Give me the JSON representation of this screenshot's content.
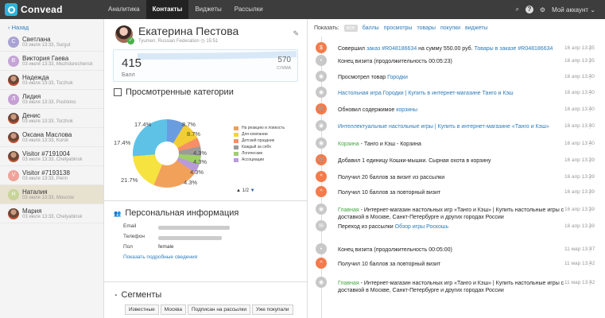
{
  "app": {
    "name": "Convead"
  },
  "nav": {
    "items": [
      {
        "label": "Аналитика"
      },
      {
        "label": "Контакты"
      },
      {
        "label": "Виджеты"
      },
      {
        "label": "Рассылки"
      }
    ],
    "account": "Мой аккаунт"
  },
  "sidebar": {
    "back": "Назад",
    "contacts": [
      {
        "name": "Светлана",
        "meta": "03 июля 13:33, Surgut",
        "initial": "С",
        "color": "#a9a3d4"
      },
      {
        "name": "Виктория Гаева",
        "meta": "03 июля 13:33, Mezhdurechensk",
        "initial": "В",
        "color": "#c5a5d6"
      },
      {
        "name": "Надежда",
        "meta": "03 июля 13:33, Torzhok",
        "initial": "",
        "color": "#9a6a5a"
      },
      {
        "name": "Лидия",
        "meta": "03 июля 13:33, Pushkino",
        "initial": "Л",
        "color": "#c6a0d4"
      },
      {
        "name": "Денис",
        "meta": "03 июля 13:33, Torzhok",
        "initial": "",
        "color": "#6f5b52"
      },
      {
        "name": "Оксана Маслова",
        "meta": "03 июля 13:33, Kursk",
        "initial": "",
        "color": "#8f6e5e"
      },
      {
        "name": "Visitor #7191004",
        "meta": "03 июля 13:33, Chelyabinsk",
        "initial": "",
        "color": "#8e6856"
      },
      {
        "name": "Visitor #7193138",
        "meta": "03 июля 13:33, Perm",
        "initial": "V",
        "color": "#f0a39a"
      },
      {
        "name": "Наталия",
        "meta": "03 июля 13:33, Moscow",
        "initial": "Н",
        "color": "#c8d49a"
      },
      {
        "name": "Мария",
        "meta": "03 июля 13:33, Chelyabinsk",
        "initial": "",
        "color": "#8d6e61"
      }
    ]
  },
  "profile": {
    "name": "Екатерина Пестова",
    "location": "Tyumen, Russian Federation",
    "time": "15:51",
    "score": "415",
    "score_label": "Балл",
    "total": "570",
    "total_label": "СУММА"
  },
  "categories": {
    "title": "Просмотренные категории",
    "legend": [
      "На реакцию и ловкость",
      "Для компании",
      "Детский праздник",
      "Каждый за себя",
      "Логические",
      "Ассоциации"
    ],
    "pager": "1/2",
    "percents": [
      "17.4%",
      "8.7%",
      "8.7%",
      "17.4%",
      "4.3%",
      "4.3%",
      "4.3%",
      "4.3%",
      "21.7%"
    ]
  },
  "personal": {
    "title": "Персональная информация",
    "email_label": "Email",
    "phone_label": "Телефон",
    "gender_label": "Пол",
    "gender": "female",
    "more_link": "Показать подробные сведения"
  },
  "segments": {
    "title": "Сегменты",
    "tags": [
      "Известные",
      "Москва",
      "Подписан на рассылки",
      "Уже покупали"
    ]
  },
  "events": {
    "filter_label": "Показать:",
    "filters": [
      "все",
      "баллы",
      "просмотры",
      "товары",
      "покупки",
      "виджеты"
    ],
    "items": [
      {
        "pre": "Совершил ",
        "link": "заказ #R048186634",
        "mid": " на сумму 550.00 руб. ",
        "link2": "Товары в заказе #R048186634",
        "date": "16 апр 13:35",
        "icon": "$",
        "color": "orange"
      },
      {
        "pre": "Конец визита (продолжительность 00:05:23)",
        "link": "",
        "mid": "",
        "link2": "",
        "date": "16 апр 13:35",
        "icon": "•",
        "color": "gray"
      },
      {
        "pre": "Просмотрел товар ",
        "link": "Городки",
        "mid": "",
        "link2": "",
        "date": "16 апр 13:40",
        "icon": "◉",
        "color": "gray"
      },
      {
        "pre": "",
        "link": "Настольная игра Городки | Купить в интернет-магазине Танго и Кэш",
        "mid": "",
        "link2": "",
        "date": "16 апр 13:40",
        "icon": "◉",
        "color": "gray"
      },
      {
        "pre": "Обновил содержимое ",
        "link": "корзины",
        "mid": "",
        "link2": "",
        "date": "16 апр 13:40",
        "icon": "🛒",
        "color": "orange"
      },
      {
        "pre": "",
        "link": "Интеллектуальные настольные игры | Купить в интернет-магазине «Танго и Кэш»",
        "mid": "",
        "link2": "",
        "date": "16 апр 13:40",
        "icon": "◉",
        "color": "gray"
      },
      {
        "pre": "",
        "link": "Корзина",
        "mid": " - Танго и Кэш - Корзина",
        "link2": "",
        "date": "16 апр 13:40",
        "icon": "◉",
        "color": "gray"
      },
      {
        "pre": "Добавил 1 единицу Кошки-мышки. Сырная охота в корзину",
        "link": "",
        "mid": "",
        "link2": "",
        "date": "16 апр 13:39",
        "icon": "🛒",
        "color": "orange"
      },
      {
        "pre": "Получил 20 баллов за визит из рассылки",
        "link": "",
        "mid": "",
        "link2": "",
        "date": "16 апр 13:39",
        "icon": "^",
        "color": "orange"
      },
      {
        "pre": "Получил 10 баллов за повторный визит",
        "link": "",
        "mid": "",
        "link2": "",
        "date": "16 апр 13:39",
        "icon": "^",
        "color": "orange"
      },
      {
        "pre": "",
        "link": "Главная",
        "mid": " - Интернет-магазин настольных игр «Танго и Кэш» | Купить настольные игры с доставкой в Москве, Санкт-Петербурге и других городах России",
        "link2": "",
        "date": "16 апр 13:39",
        "icon": "◉",
        "color": "gray"
      },
      {
        "pre": "Переход из рассылки ",
        "link": "Обзор игры Роскошь",
        "mid": "",
        "link2": "",
        "date": "16 апр 13:39",
        "icon": "✉",
        "color": "gray"
      },
      {
        "pre": "Конец визита (продолжительность 00:05:00)",
        "link": "",
        "mid": "",
        "link2": "",
        "date": "11 мар 13:47",
        "icon": "•",
        "color": "gray"
      },
      {
        "pre": "Получил 10 баллов за повторный визит",
        "link": "",
        "mid": "",
        "link2": "",
        "date": "11 мар 13:42",
        "icon": "^",
        "color": "orange"
      },
      {
        "pre": "",
        "link": "Главная",
        "mid": " - Интернет-магазин настольных игр «Танго и Кэш» | Купить настольные игры с доставкой в Москве, Санкт-Петербурге и других городах России",
        "link2": "",
        "date": "11 мар 13:42",
        "icon": "◉",
        "color": "gray"
      }
    ]
  }
}
